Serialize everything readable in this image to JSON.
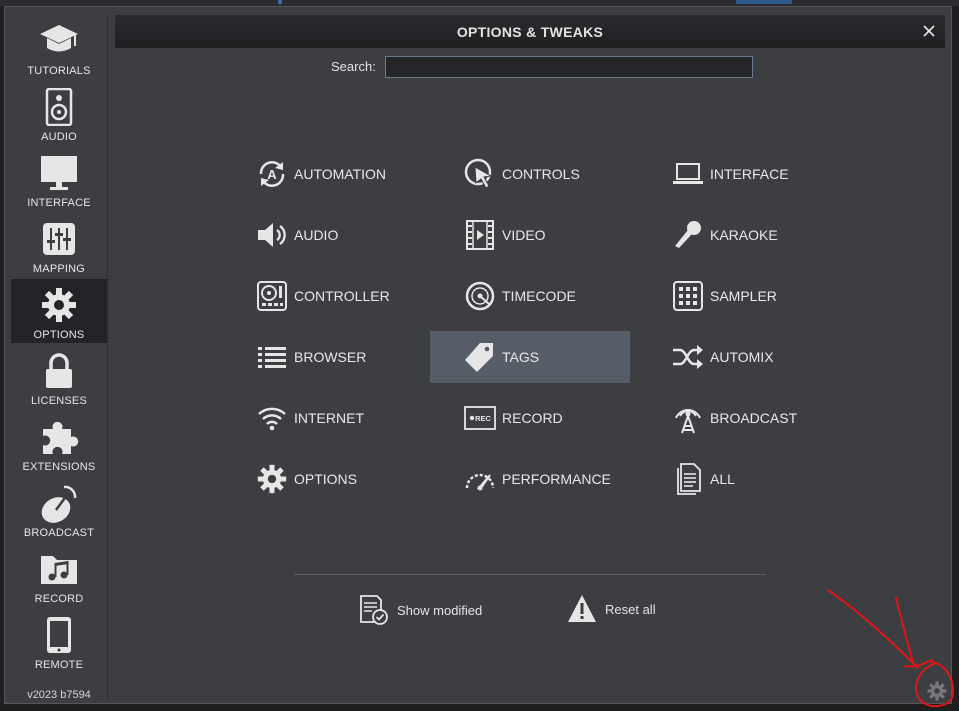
{
  "window": {
    "title": "OPTIONS & TWEAKS"
  },
  "search": {
    "label": "Search:",
    "value": ""
  },
  "sidebar": {
    "items": [
      {
        "label": "TUTORIALS",
        "icon": "graduation-cap-icon"
      },
      {
        "label": "AUDIO",
        "icon": "speaker-icon"
      },
      {
        "label": "INTERFACE",
        "icon": "monitor-icon"
      },
      {
        "label": "MAPPING",
        "icon": "sliders-icon"
      },
      {
        "label": "OPTIONS",
        "icon": "gear-icon",
        "active": true
      },
      {
        "label": "LICENSES",
        "icon": "lock-icon"
      },
      {
        "label": "EXTENSIONS",
        "icon": "puzzle-icon"
      },
      {
        "label": "BROADCAST",
        "icon": "satellite-dish-icon"
      },
      {
        "label": "RECORD",
        "icon": "music-folder-icon"
      },
      {
        "label": "REMOTE",
        "icon": "phone-icon"
      }
    ],
    "version": "v2023 b7594"
  },
  "categories": [
    {
      "label": "AUTOMATION",
      "icon": "automation-icon"
    },
    {
      "label": "CONTROLS",
      "icon": "cursor-click-icon"
    },
    {
      "label": "INTERFACE",
      "icon": "laptop-icon"
    },
    {
      "label": "AUDIO",
      "icon": "volume-icon"
    },
    {
      "label": "VIDEO",
      "icon": "film-icon"
    },
    {
      "label": "KARAOKE",
      "icon": "microphone-icon"
    },
    {
      "label": "CONTROLLER",
      "icon": "controller-icon"
    },
    {
      "label": "TIMECODE",
      "icon": "vinyl-icon"
    },
    {
      "label": "SAMPLER",
      "icon": "pad-grid-icon"
    },
    {
      "label": "BROWSER",
      "icon": "list-icon"
    },
    {
      "label": "TAGS",
      "icon": "tag-icon",
      "selected": true
    },
    {
      "label": "AUTOMIX",
      "icon": "shuffle-icon"
    },
    {
      "label": "INTERNET",
      "icon": "wifi-icon"
    },
    {
      "label": "RECORD",
      "icon": "rec-icon"
    },
    {
      "label": "BROADCAST",
      "icon": "antenna-icon"
    },
    {
      "label": "OPTIONS",
      "icon": "gear-icon"
    },
    {
      "label": "PERFORMANCE",
      "icon": "gauge-icon"
    },
    {
      "label": "ALL",
      "icon": "document-icon"
    }
  ],
  "footer": {
    "show_modified": "Show modified",
    "reset_all": "Reset all"
  },
  "colors": {
    "selected_bg": "#575d66",
    "annotation": "#e01515"
  }
}
